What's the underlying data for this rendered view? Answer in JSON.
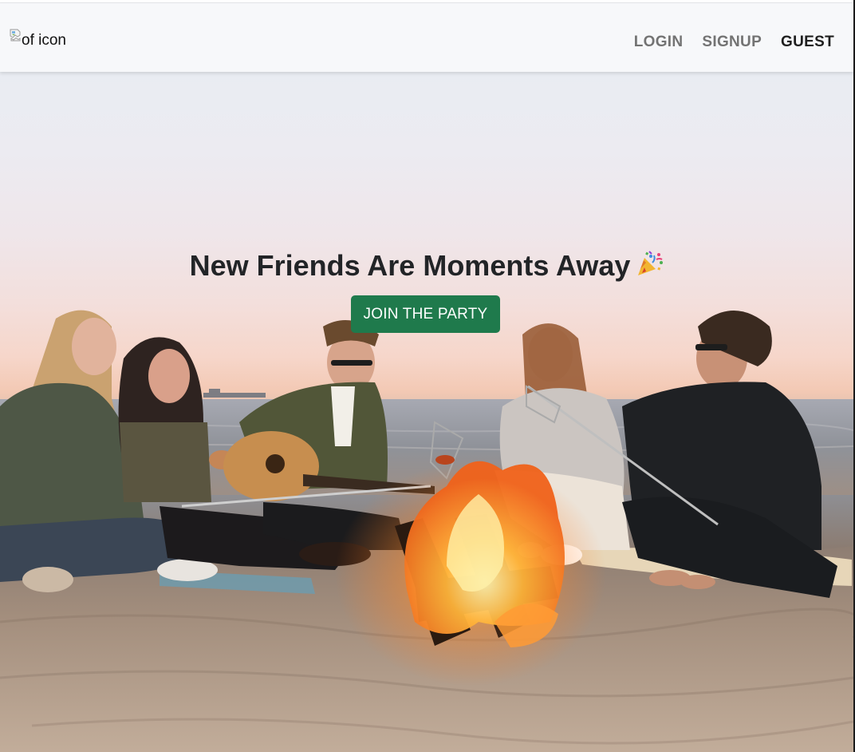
{
  "navbar": {
    "logo_alt_text": "of icon",
    "links": [
      {
        "label": "LOGIN",
        "active": false
      },
      {
        "label": "SIGNUP",
        "active": false
      },
      {
        "label": "GUEST",
        "active": true
      }
    ]
  },
  "hero": {
    "headline": "New Friends Are Moments Away",
    "headline_icon": "party-popper-icon",
    "cta_label": "JOIN THE PARTY",
    "photo_subject": "friends-around-beach-bonfire-photo"
  },
  "colors": {
    "accent": "#1f7a4c",
    "navbar_bg": "#f7f8fa",
    "nav_inactive": "#737373",
    "nav_active": "#1f1f1f",
    "headline": "#222427"
  }
}
